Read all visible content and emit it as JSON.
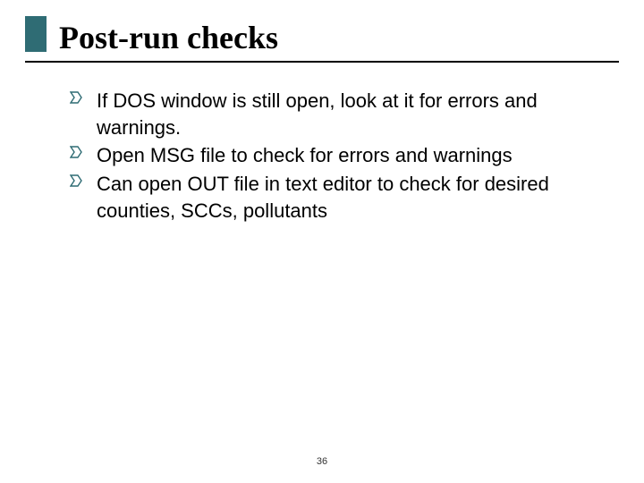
{
  "title": "Post-run checks",
  "bullets": [
    "If DOS window is still open, look at it for errors and warnings.",
    "Open MSG file to check for errors and warnings",
    "Can open OUT file in text editor to check for desired counties, SCCs, pollutants"
  ],
  "page_number": "36",
  "colors": {
    "accent": "#2f6c74"
  }
}
